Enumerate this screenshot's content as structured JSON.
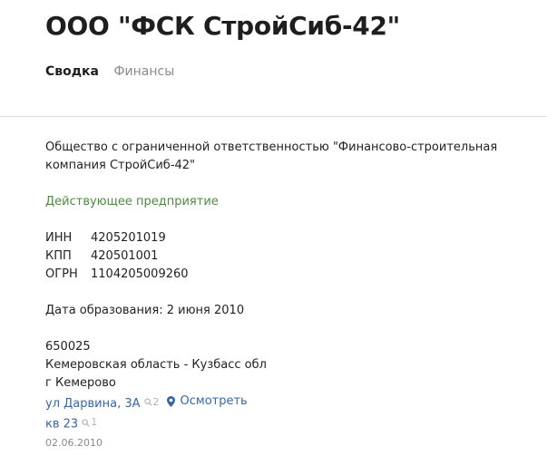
{
  "company": {
    "title": "ООО \"ФСК СтройСиб-42\"",
    "full_name": "Общество с ограниченной ответственностью \"Финансово-строительная компания СтройСиб-42\"",
    "status": "Действующее предприятие"
  },
  "tabs": [
    {
      "label": "Сводка",
      "active": true
    },
    {
      "label": "Финансы",
      "active": false
    }
  ],
  "identifiers": [
    {
      "label": "ИНН",
      "value": "4205201019"
    },
    {
      "label": "КПП",
      "value": "420501001"
    },
    {
      "label": "ОГРН",
      "value": "1104205009260"
    }
  ],
  "founded": "Дата образования: 2 июня 2010",
  "address": {
    "postal_code": "650025",
    "region": "Кемеровская область - Кузбасс обл",
    "city": "г Кемерово",
    "street": "ул Дарвина, 3А",
    "street_search_count": "2",
    "show_on_map_label": "Осмотреть",
    "apartment": "кв 23",
    "apartment_search_count": "1",
    "date": "02.06.2010"
  },
  "icons": {
    "search": "search-icon",
    "map_pin": "map-pin-icon"
  },
  "colors": {
    "status_green": "#4c8c3c",
    "link_blue": "#3567a6",
    "muted_gray": "#8a8a8a"
  }
}
